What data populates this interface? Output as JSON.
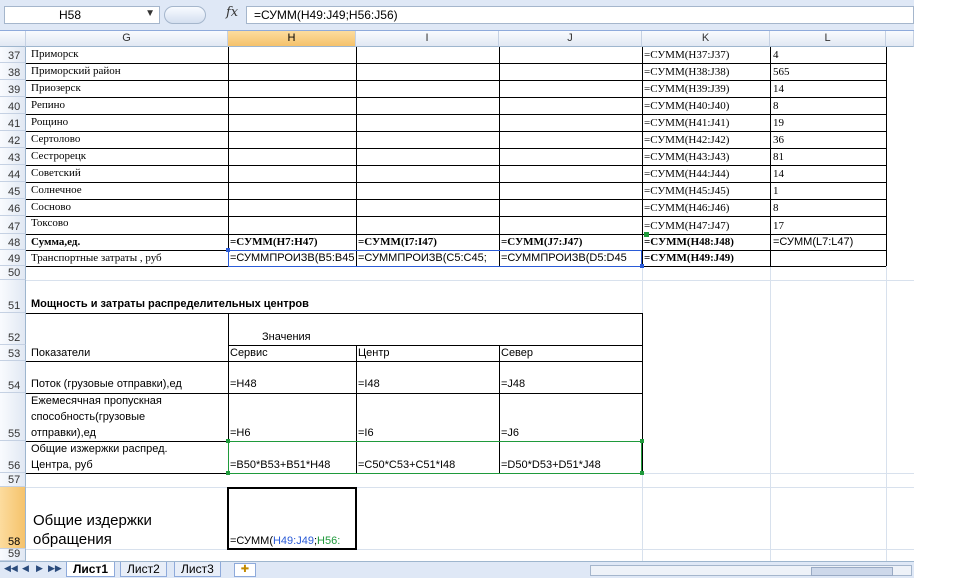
{
  "formula_bar": {
    "name_box": "H58",
    "fx_symbol": "fx",
    "formula": "=СУММ(H49:J49;H56:J56)"
  },
  "columns": [
    "G",
    "H",
    "I",
    "J",
    "K",
    "L"
  ],
  "rows": {
    "r37": {
      "num": "37",
      "g": "Приморск",
      "k": "=СУММ(H37:J37)",
      "l": "4"
    },
    "r38": {
      "num": "38",
      "g": "Приморский район",
      "k": "=СУММ(H38:J38)",
      "l": "565"
    },
    "r39": {
      "num": "39",
      "g": "Приозерск",
      "k": "=СУММ(H39:J39)",
      "l": "14"
    },
    "r40": {
      "num": "40",
      "g": "Репино",
      "k": "=СУММ(H40:J40)",
      "l": "8"
    },
    "r41": {
      "num": "41",
      "g": "Рощино",
      "k": "=СУММ(H41:J41)",
      "l": "19"
    },
    "r42": {
      "num": "42",
      "g": "Сертолово",
      "k": "=СУММ(H42:J42)",
      "l": "36"
    },
    "r43": {
      "num": "43",
      "g": "Сестрорецк",
      "k": "=СУММ(H43:J43)",
      "l": "81"
    },
    "r44": {
      "num": "44",
      "g": "Советский",
      "k": "=СУММ(H44:J44)",
      "l": "14"
    },
    "r45": {
      "num": "45",
      "g": "Солнечное",
      "k": "=СУММ(H45:J45)",
      "l": "1"
    },
    "r46": {
      "num": "46",
      "g": "Сосново",
      "k": "=СУММ(H46:J46)",
      "l": "8"
    },
    "r47": {
      "num": "47",
      "g": "Токсово",
      "k": "=СУММ(H47:J47)",
      "l": "17"
    },
    "r48": {
      "num": "48",
      "g": "Сумма,ед.",
      "h": "=СУММ(H7:H47)",
      "i": "=СУММ(I7:I47)",
      "j": "=СУММ(J7:J47)",
      "k": "=СУММ(H48:J48)",
      "l": "=СУММ(L7:L47)"
    },
    "r49": {
      "num": "49",
      "g": "Транспортные затраты , руб",
      "h": "=СУММПРОИЗВ(B5:B45",
      "i": "=СУММПРОИЗВ(C5:C45;",
      "j": "=СУММПРОИЗВ(D5:D45",
      "k": "=СУММ(H49:J49)"
    },
    "r50": {
      "num": "50"
    },
    "r51": {
      "num": "51",
      "g": "Мощность и затраты распределительных центров"
    },
    "r52": {
      "num": "52",
      "h": "Значения"
    },
    "r53": {
      "num": "53",
      "g": "Показатели",
      "h": "Сервис",
      "i": "Центр",
      "j": "Север"
    },
    "r54": {
      "num": "54",
      "g": "Поток (грузовые отправки),ед",
      "h": "=H48",
      "i": "=I48",
      "j": "=J48"
    },
    "r55": {
      "num": "55",
      "g1": "Ежемесячная пропускная",
      "g2": "способность(грузовые",
      "g3": "отправки),ед",
      "h": "=H6",
      "i": "=I6",
      "j": "=J6"
    },
    "r56": {
      "num": "56",
      "g1": "Общие изжержки распред.",
      "g2": "Центра, руб",
      "h": "=B50*B53+B51*H48",
      "i": "=C50*C53+C51*I48",
      "j": "=D50*D53+D51*J48"
    },
    "r57": {
      "num": "57"
    },
    "r58": {
      "num": "58",
      "g1": "Общие издержки",
      "g2": "обращения",
      "h_prefix": "=СУММ(",
      "h_ref1": "H49:J49",
      "h_sep": ";",
      "h_ref2": "H56:"
    },
    "r59": {
      "num": "59"
    }
  },
  "sheet_tabs": [
    "Лист1",
    "Лист2",
    "Лист3"
  ],
  "active_tab": "Лист1"
}
